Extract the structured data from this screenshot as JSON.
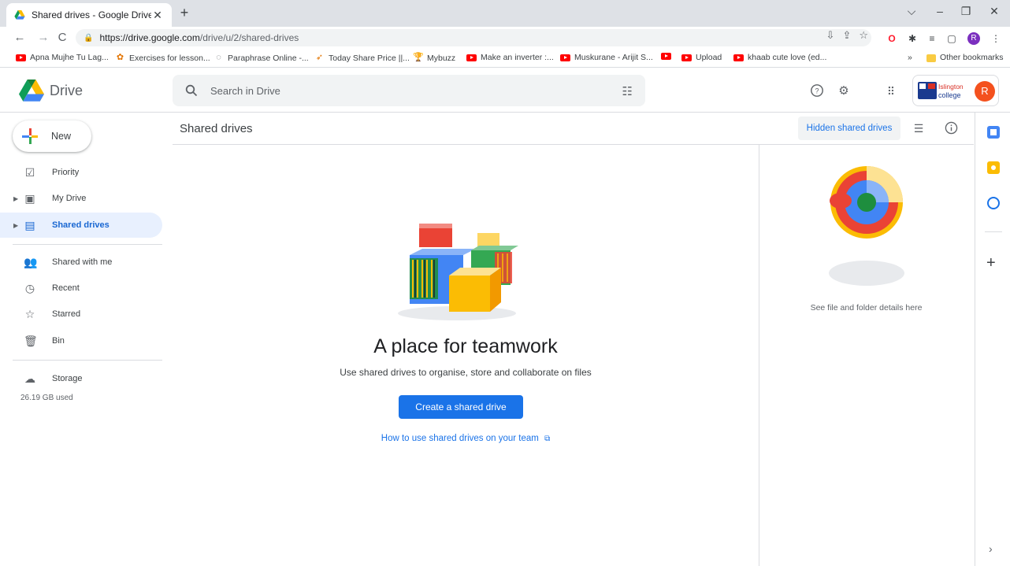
{
  "browser": {
    "tab_title": "Shared drives - Google Drive",
    "tab_close": "✕",
    "new_tab": "+",
    "url_host": "https://drive.google.com",
    "url_path": "/drive/u/2/shared-drives",
    "profile_initial": "R",
    "bookmarks": [
      {
        "label": "Apna Mujhe Tu Lag...",
        "icon": "youtube-icon"
      },
      {
        "label": "Exercises for lesson...",
        "icon": "app-icon"
      },
      {
        "label": "Paraphrase Online -...",
        "icon": "globe-icon"
      },
      {
        "label": "Today Share Price ||...",
        "icon": "stock-icon"
      },
      {
        "label": "Mybuzz",
        "icon": "trophy-icon"
      },
      {
        "label": "Make an inverter :...",
        "icon": "youtube-icon"
      },
      {
        "label": "Muskurane - Arijit S...",
        "icon": "youtube-icon"
      },
      {
        "label": "",
        "icon": "youtube-icon"
      },
      {
        "label": "Upload",
        "icon": "youtube-icon"
      },
      {
        "label": "khaab cute love (ed...",
        "icon": "youtube-icon"
      }
    ],
    "more_bookmarks": "»",
    "other_bookmarks": "Other bookmarks"
  },
  "header": {
    "app_name": "Drive",
    "search_placeholder": "Search in Drive",
    "org_line1": "Islington",
    "org_line2": "college",
    "avatar_initial": "R"
  },
  "nav": {
    "new_label": "New",
    "items": [
      {
        "label": "Priority",
        "icon": "priority-icon"
      },
      {
        "label": "My Drive",
        "icon": "my-drive-icon"
      },
      {
        "label": "Shared drives",
        "icon": "shared-drives-icon",
        "active": true
      },
      {
        "label": "Shared with me",
        "icon": "people-icon"
      },
      {
        "label": "Recent",
        "icon": "clock-icon"
      },
      {
        "label": "Starred",
        "icon": "star-icon"
      },
      {
        "label": "Bin",
        "icon": "bin-icon"
      },
      {
        "label": "Storage",
        "icon": "cloud-icon"
      }
    ],
    "storage_used": "26.19 GB used"
  },
  "main": {
    "title": "Shared drives",
    "hidden_shared_drives": "Hidden shared drives",
    "headline": "A place for teamwork",
    "subline": "Use shared drives to organise, store and collaborate on files",
    "create_button": "Create a shared drive",
    "howto_link": "How to use shared drives on your team"
  },
  "details": {
    "placeholder_text": "See file and folder details here"
  },
  "colors": {
    "accent": "#1a73e8",
    "active_bg": "#e8f0fe",
    "active_text": "#1967d2"
  }
}
